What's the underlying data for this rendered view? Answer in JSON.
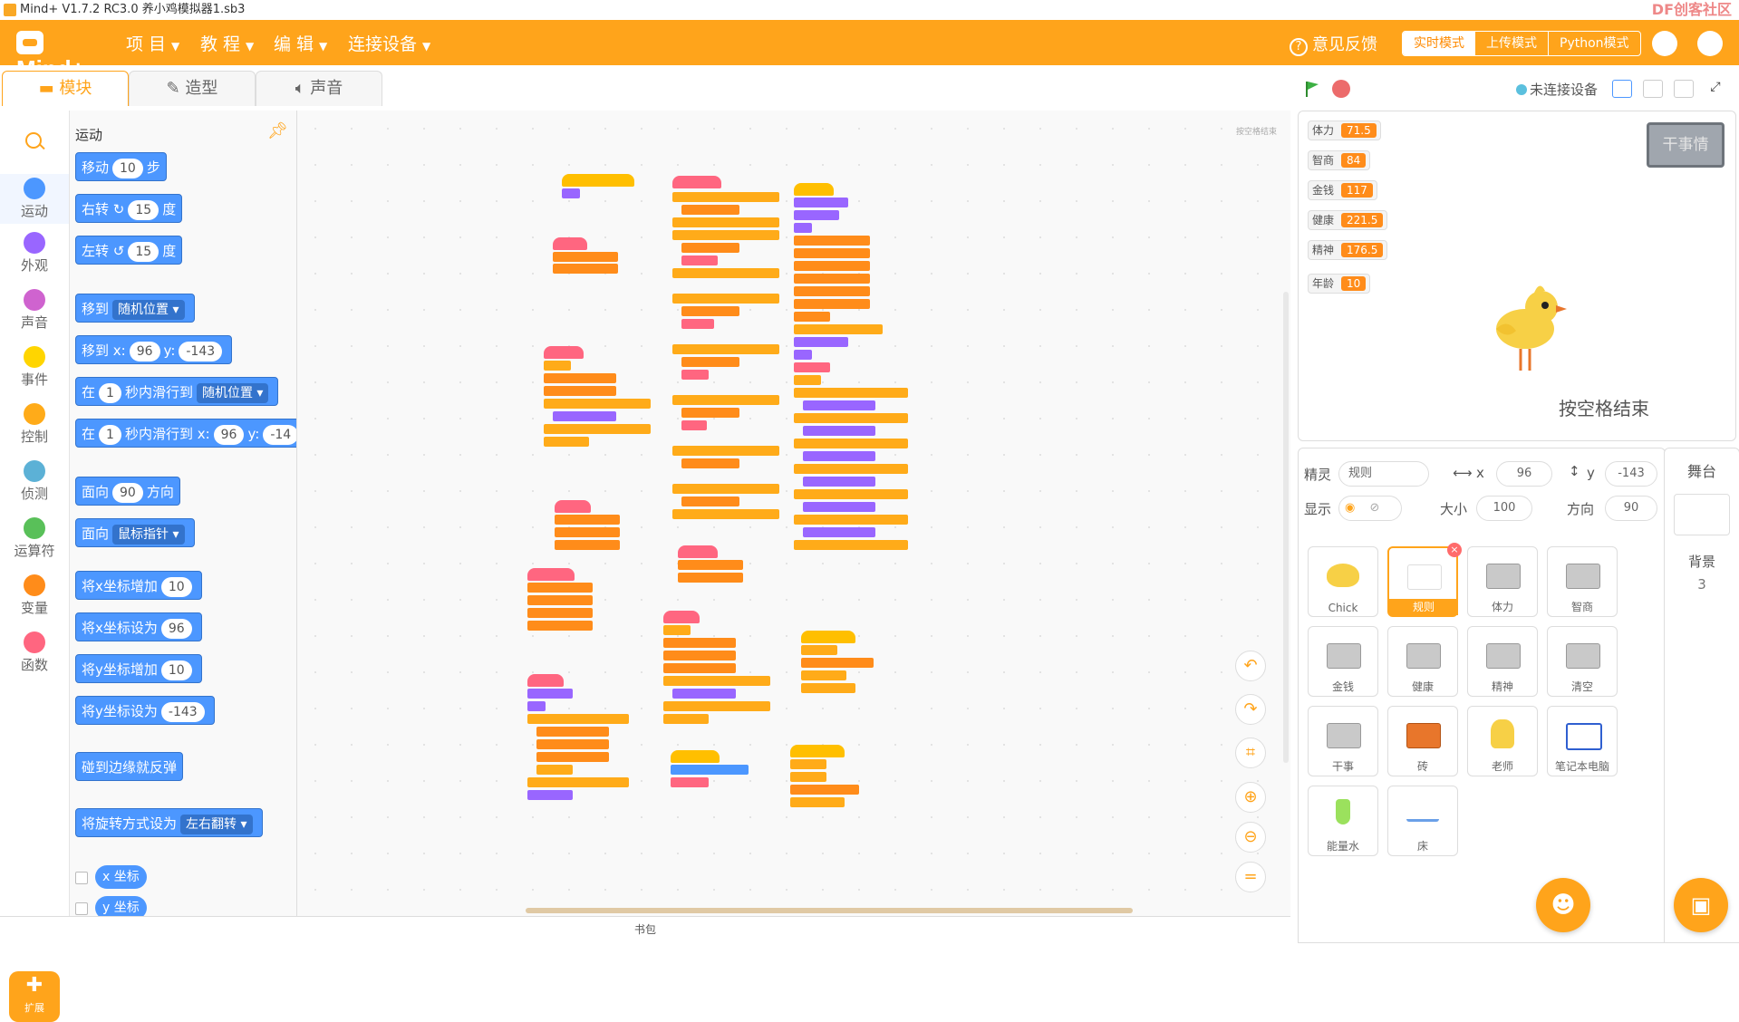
{
  "titlebar": {
    "title": "Mind+ V1.7.2 RC3.0    养小鸡模拟器1.sb3",
    "watermark": "DF创客社区",
    "watermark_url": "mc.DFRobot.com.cn"
  },
  "menu": {
    "items": [
      "项 目",
      "教 程",
      "编 辑",
      "连接设备"
    ],
    "feedback": "意见反馈",
    "modes": [
      "实时模式",
      "上传模式",
      "Python模式"
    ]
  },
  "tabs": [
    "模块",
    "造型",
    "声音"
  ],
  "categories": [
    {
      "label": "运动",
      "color": "#4c97ff"
    },
    {
      "label": "外观",
      "color": "#9966ff"
    },
    {
      "label": "声音",
      "color": "#cf63cf"
    },
    {
      "label": "事件",
      "color": "#ffd500"
    },
    {
      "label": "控制",
      "color": "#ffab19"
    },
    {
      "label": "侦测",
      "color": "#5cb1d6"
    },
    {
      "label": "运算符",
      "color": "#59c059"
    },
    {
      "label": "变量",
      "color": "#ff8c1a"
    },
    {
      "label": "函数",
      "color": "#ff6680"
    }
  ],
  "extension_label": "扩展",
  "palette": {
    "title": "运动",
    "blocks": {
      "move": {
        "a": "移动",
        "v": "10",
        "b": "步"
      },
      "turn_right": {
        "a": "右转",
        "icon": "↻",
        "v": "15",
        "b": "度"
      },
      "turn_left": {
        "a": "左转",
        "icon": "↺",
        "v": "15",
        "b": "度"
      },
      "goto": {
        "a": "移到",
        "dd": "随机位置 ▾"
      },
      "goto_xy": {
        "a": "移到 x:",
        "x": "96",
        "b": "y:",
        "y": "-143"
      },
      "glide": {
        "a": "在",
        "v": "1",
        "b": "秒内滑行到",
        "dd": "随机位置 ▾"
      },
      "glide_xy": {
        "a": "在",
        "v": "1",
        "b": "秒内滑行到 x:",
        "x": "96",
        "c": "y:",
        "y": "-14"
      },
      "point_dir": {
        "a": "面向",
        "v": "90",
        "b": "方向"
      },
      "point_towards": {
        "a": "面向",
        "dd": "鼠标指针 ▾"
      },
      "change_x": {
        "a": "将x坐标增加",
        "v": "10"
      },
      "set_x": {
        "a": "将x坐标设为",
        "v": "96"
      },
      "change_y": {
        "a": "将y坐标增加",
        "v": "10"
      },
      "set_y": {
        "a": "将y坐标设为",
        "v": "-143"
      },
      "bounce": {
        "a": "碰到边缘就反弹"
      },
      "rotation": {
        "a": "将旋转方式设为",
        "dd": "左右翻转 ▾"
      },
      "x_rep": "x 坐标",
      "y_rep": "y 坐标"
    }
  },
  "workspace": {
    "backpack": "书包",
    "corner_note": "按空格结束"
  },
  "stage_bar": {
    "connection": "未连接设备"
  },
  "stage": {
    "variables": [
      {
        "name": "体力",
        "value": "71.5"
      },
      {
        "name": "智商",
        "value": "84"
      },
      {
        "name": "金钱",
        "value": "117"
      },
      {
        "name": "健康",
        "value": "221.5"
      },
      {
        "name": "精神",
        "value": "176.5"
      },
      {
        "name": "年龄",
        "value": "10"
      }
    ],
    "button_label": "干事情",
    "caption": "按空格结束"
  },
  "sprite_info": {
    "sprite_label": "精灵",
    "sprite_name": "规则",
    "x_label": "x",
    "x": "96",
    "y_label": "y",
    "y": "-143",
    "show_label": "显示",
    "size_label": "大小",
    "size": "100",
    "dir_label": "方向",
    "dir": "90"
  },
  "sprites": [
    "Chick",
    "规则",
    "体力",
    "智商",
    "金钱",
    "健康",
    "精神",
    "清空",
    "干事",
    "砖",
    "老师",
    "笔记本电脑",
    "能量水",
    "床"
  ],
  "stage_panel": {
    "title": "舞台",
    "bg_label": "背景",
    "bg_count": "3"
  },
  "colors": {
    "accent": "#ffa41b",
    "motion": "#4c97ff"
  }
}
